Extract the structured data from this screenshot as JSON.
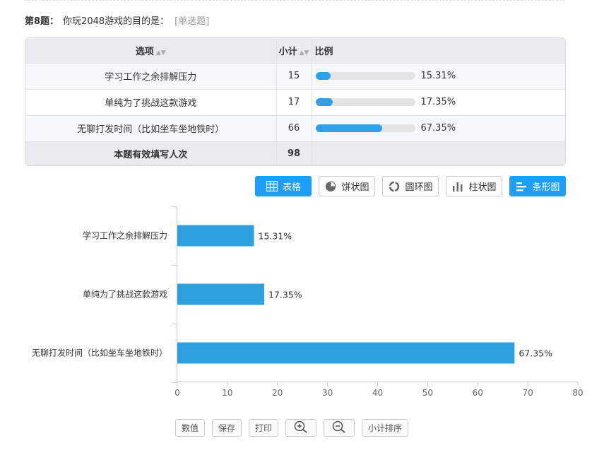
{
  "question": {
    "number_label": "第8题：",
    "text": "你玩2048游戏的目的是：",
    "type_label": "[单选题]"
  },
  "table": {
    "headers": {
      "option": "选项",
      "count": "小计",
      "ratio": "比例"
    },
    "rows": [
      {
        "option": "学习工作之余排解压力",
        "count": "15",
        "percent": "15.31%",
        "fraction": 0.1531
      },
      {
        "option": "单纯为了挑战这款游戏",
        "count": "17",
        "percent": "17.35%",
        "fraction": 0.1735
      },
      {
        "option": "无聊打发时间（比如坐车坐地铁时）",
        "count": "66",
        "percent": "67.35%",
        "fraction": 0.6735
      }
    ],
    "total_label": "本题有效填写人次",
    "total_value": "98"
  },
  "view_buttons": {
    "table": "表格",
    "pie": "饼状图",
    "donut": "圆环图",
    "column": "柱状图",
    "bar": "条形图"
  },
  "chart_data": {
    "type": "bar",
    "orientation": "horizontal",
    "categories": [
      "学习工作之余排解压力",
      "单纯为了挑战这款游戏",
      "无聊打发时间（比如坐车坐地铁时）"
    ],
    "values": [
      15.31,
      17.35,
      67.35
    ],
    "data_labels": [
      "15.31%",
      "17.35%",
      "67.35%"
    ],
    "xlim": [
      0,
      80
    ],
    "xticks": [
      "0",
      "10",
      "20",
      "30",
      "40",
      "50",
      "60",
      "70",
      "80"
    ],
    "bar_color": "#2fa0de",
    "grid": false
  },
  "tools": {
    "values": "数值",
    "save": "保存",
    "print": "打印",
    "sort": "小计排序"
  },
  "colors": {
    "accent": "#1e9fff",
    "bar": "#2fa1ec"
  }
}
